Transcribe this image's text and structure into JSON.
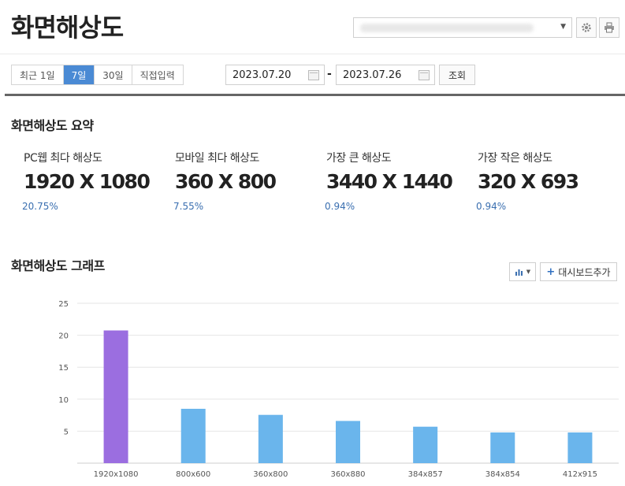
{
  "header": {
    "title": "화면해상도"
  },
  "toolbar": {
    "settings_icon": "gear-icon",
    "print_icon": "print-icon"
  },
  "filter": {
    "periods": [
      "최근 1일",
      "7일",
      "30일",
      "직접입력"
    ],
    "active_period": "7일",
    "start_date": "2023.07.20",
    "end_date": "2023.07.26",
    "search_label": "조회"
  },
  "summary": {
    "title": "화면해상도 요약",
    "items": [
      {
        "label": "PC웹 최다 해상도",
        "value": "1920 X 1080",
        "pct": "20.75%"
      },
      {
        "label": "모바일 최다 해상도",
        "value": "360 X 800",
        "pct": "7.55%"
      },
      {
        "label": "가장 큰 해상도",
        "value": "3440 X 1440",
        "pct": "0.94%"
      },
      {
        "label": "가장 작은 해상도",
        "value": "320 X 693",
        "pct": "0.94%"
      }
    ]
  },
  "graph": {
    "title": "화면해상도 그래프",
    "add_dashboard_label": "대시보드추가",
    "chart_type_icon": "bar-chart-icon"
  },
  "colors": {
    "accent": "#4a8ad4",
    "highlight_bar": "#9b6ee0",
    "bar": "#6ab5ec",
    "pct_text": "#3a6fb0"
  },
  "chart_data": {
    "type": "bar",
    "categories": [
      "1920x1080",
      "800x600",
      "360x800",
      "360x880",
      "384x857",
      "384x854",
      "412x915"
    ],
    "values": [
      20.75,
      8.5,
      7.55,
      6.6,
      5.7,
      4.8,
      4.8
    ],
    "highlight_index": 0,
    "title": "",
    "xlabel": "",
    "ylabel": "",
    "ylim": [
      0,
      25
    ],
    "yticks": [
      5,
      10,
      15,
      20,
      25
    ],
    "grid": true,
    "legend": "none"
  }
}
